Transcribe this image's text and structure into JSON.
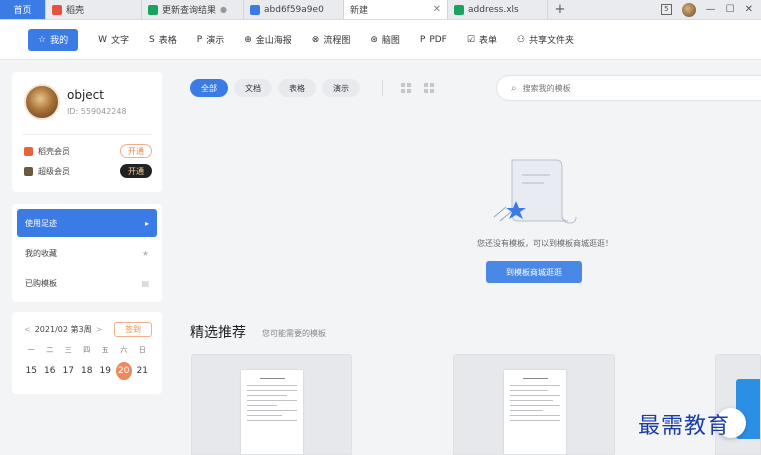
{
  "tabs": [
    {
      "label": "首页",
      "type": "home"
    },
    {
      "label": "稻壳",
      "badge_color": "#e5533d"
    },
    {
      "label": "更新查询结果",
      "badge_color": "#1aa260"
    },
    {
      "label": "abd6f59a9e0",
      "badge_color": "#3b7be6"
    },
    {
      "label": "新建",
      "active": true
    },
    {
      "label": "address.xls",
      "badge_color": "#1aa260"
    }
  ],
  "window": {
    "sq_label": "5",
    "min": "—",
    "max": "☐",
    "close": "✕",
    "plus": "+",
    "tab_close": "✕",
    "tab_pin": "●"
  },
  "toolbar": [
    {
      "label": "我的",
      "icon": "☆"
    },
    {
      "label": "文字",
      "icon": "W"
    },
    {
      "label": "表格",
      "icon": "S"
    },
    {
      "label": "演示",
      "icon": "P"
    },
    {
      "label": "金山海报",
      "icon": "⊕"
    },
    {
      "label": "流程图",
      "icon": "⊗"
    },
    {
      "label": "脑图",
      "icon": "⊛"
    },
    {
      "label": "PDF",
      "icon": "P"
    },
    {
      "label": "表单",
      "icon": "☑"
    },
    {
      "label": "共享文件夹",
      "icon": "⚇"
    }
  ],
  "user": {
    "name": "object",
    "id": "ID: 559042248"
  },
  "members": [
    {
      "label": "稻壳会员",
      "button": "开通",
      "color": "#e8623a"
    },
    {
      "label": "超级会员",
      "button": "开通",
      "color": "#6b5a3e"
    }
  ],
  "nav": [
    {
      "label": "使用足迹",
      "icon": "▸"
    },
    {
      "label": "我的收藏",
      "icon": "★"
    },
    {
      "label": "已购模板",
      "icon": "▤"
    }
  ],
  "calendar": {
    "prev": "<",
    "month": "2021/02 第3周",
    "next": ">",
    "signin": "签到",
    "weekdays": [
      "一",
      "二",
      "三",
      "四",
      "五",
      "六",
      "日"
    ],
    "days": [
      "15",
      "16",
      "17",
      "18",
      "19",
      "20",
      "21"
    ],
    "today": "20"
  },
  "filters": [
    "全部",
    "文档",
    "表格",
    "演示"
  ],
  "search": {
    "placeholder": "搜索我的模板",
    "icon": "⌕"
  },
  "empty": {
    "message": "您还没有模板，可以到模板商城逛逛！",
    "button": "到模板商城逛逛"
  },
  "recommend": {
    "title": "精选推荐",
    "subtitle": "您可能需要的模板"
  },
  "watermark": "最需教育",
  "colors": {
    "accent": "#3b7be6",
    "orange": "#f08a5d"
  }
}
